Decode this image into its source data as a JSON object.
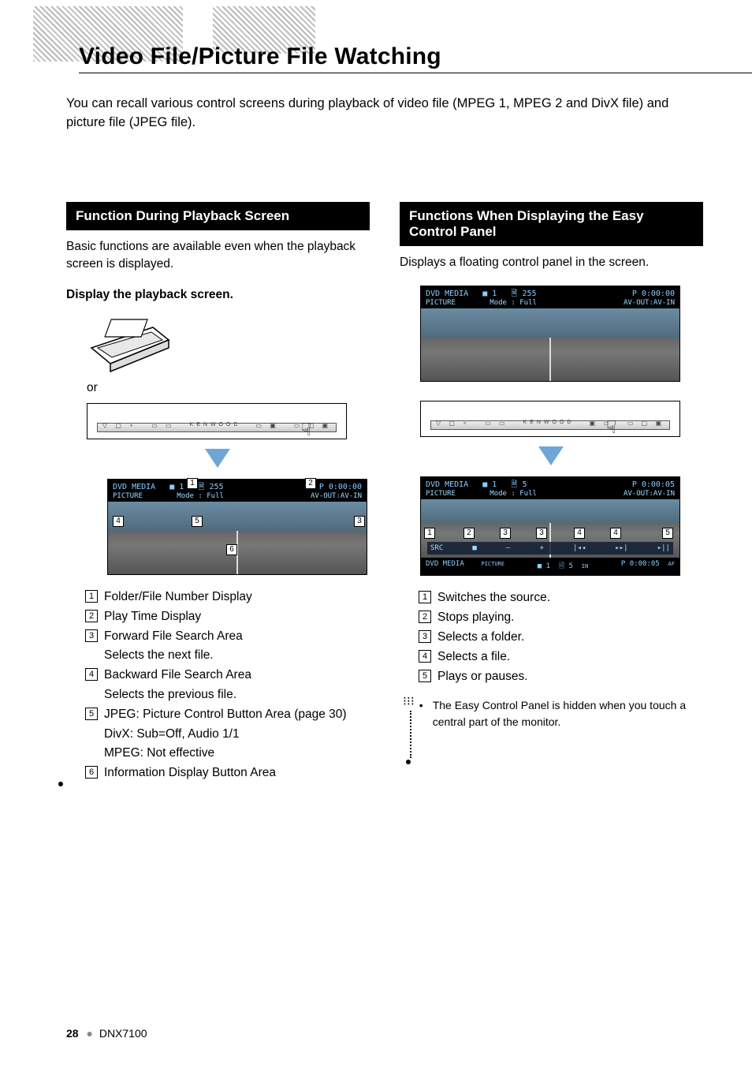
{
  "header": {
    "title": "Video File/Picture File Watching"
  },
  "intro": "You can recall various control screens during playback of video file (MPEG 1, MPEG 2 and DivX file) and picture file (JPEG file).",
  "left": {
    "bar": "Function During Playback Screen",
    "lead": "Basic functions are available even when the playback screen is displayed.",
    "subhead": "Display the playback screen.",
    "or": "or",
    "screen": {
      "source": "DVD MEDIA",
      "picture_tag": "PICTURE",
      "folder_no": "1",
      "file_no": "255",
      "play_time": "P 0:00:00",
      "mode": "Mode : Full",
      "avout": "AV-OUT:AV-IN"
    },
    "callout_nums": {
      "n1": "1",
      "n2": "2",
      "n3": "3",
      "n4": "4",
      "n5": "5",
      "n6": "6"
    },
    "legend": [
      {
        "n": "1",
        "text": "Folder/File Number Display"
      },
      {
        "n": "2",
        "text": "Play Time Display"
      },
      {
        "n": "3",
        "text": "Forward File Search Area",
        "sub": "Selects the next file."
      },
      {
        "n": "4",
        "text": "Backward File Search Area",
        "sub": "Selects the previous file."
      },
      {
        "n": "5",
        "text": "JPEG:  Picture Control Button Area (page 30)",
        "sub2": "DivX:   Sub=Off, Audio 1/1",
        "sub3": "MPEG: Not effective"
      },
      {
        "n": "6",
        "text": "Information Display Button Area"
      }
    ]
  },
  "right": {
    "bar": "Functions When Displaying the Easy Control Panel",
    "lead": "Displays a floating control panel in the screen.",
    "screen1": {
      "source": "DVD MEDIA",
      "picture_tag": "PICTURE",
      "folder_no": "1",
      "file_no": "255",
      "play_time": "P 0:00:00",
      "mode": "Mode : Full",
      "avout": "AV-OUT:AV-IN"
    },
    "screen2": {
      "source": "DVD MEDIA",
      "picture_tag": "PICTURE",
      "folder_no": "1",
      "file_no": "5",
      "play_time": "P 0:00:05",
      "mode": "Mode : Full",
      "avout": "AV-OUT:AV-IN"
    },
    "easybar": {
      "left": "DVD MEDIA",
      "picture_tag": "PICTURE",
      "center_folder": "1",
      "center_file": "5",
      "in": "IN",
      "af": "AF",
      "time": "P 0:00:05"
    },
    "callout_nums": {
      "n1": "1",
      "n2": "2",
      "n3": "3",
      "n4": "4",
      "n5": "5"
    },
    "legend": [
      {
        "n": "1",
        "text": "Switches the source."
      },
      {
        "n": "2",
        "text": "Stops playing."
      },
      {
        "n": "3",
        "text": "Selects a folder."
      },
      {
        "n": "4",
        "text": "Selects a file."
      },
      {
        "n": "5",
        "text": "Plays or pauses."
      }
    ],
    "note": "The Easy Control Panel is hidden when you touch a central part of the monitor."
  },
  "footer": {
    "page": "28",
    "model": "DNX7100"
  }
}
